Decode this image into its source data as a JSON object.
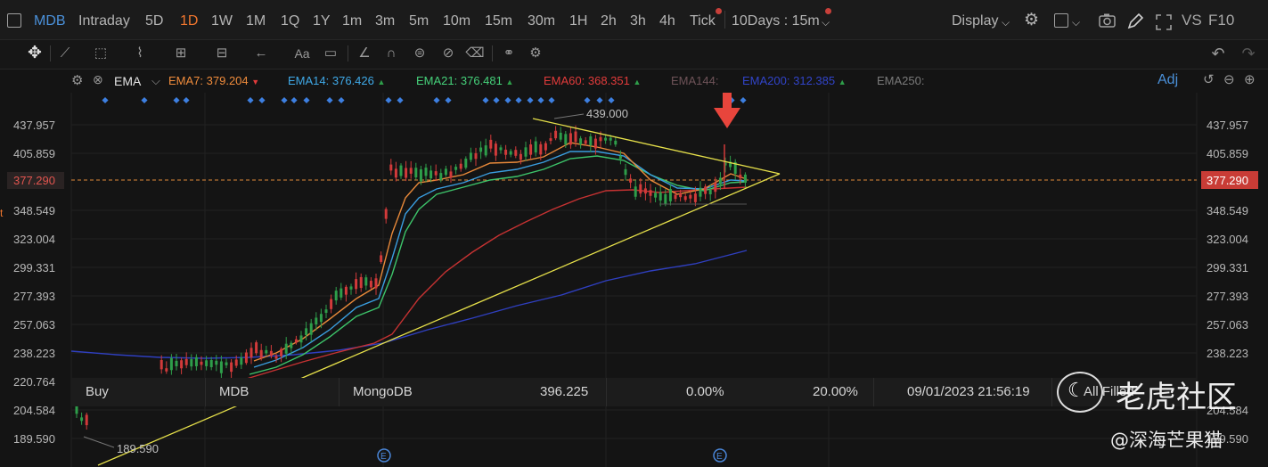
{
  "topbar": {
    "symbol": "MDB",
    "timeframes": [
      "Intraday",
      "5D",
      "1D",
      "1W",
      "1M",
      "1Q",
      "1Y",
      "1m",
      "3m",
      "5m",
      "10m",
      "15m",
      "30m",
      "1H",
      "2h",
      "3h",
      "4h",
      "Tick"
    ],
    "active_timeframe": "1D",
    "range_select": "10Days : 15m",
    "display_label": "Display",
    "vs_label": "VS",
    "f10_label": "F10"
  },
  "icons": {
    "settings": "gear-icon",
    "layout": "square-icon",
    "camera": "camera-icon",
    "pen": "pen-icon",
    "expand": "expand-icon",
    "undo": "undo-icon",
    "redo": "redo-icon",
    "move": "crosshair-move-icon"
  },
  "indicator_bar": {
    "name": "EMA",
    "items": [
      {
        "label": "EMA7:",
        "value": "379.204",
        "arrow": "▼",
        "color": "#f08c3c"
      },
      {
        "label": "EMA14:",
        "value": "376.426",
        "arrow": "▲",
        "color": "#3fa9e8"
      },
      {
        "label": "EMA21:",
        "value": "376.481",
        "arrow": "▲",
        "color": "#45d17a"
      },
      {
        "label": "EMA60:",
        "value": "368.351",
        "arrow": "▲",
        "color": "#e23b3b"
      },
      {
        "label": "EMA144:",
        "value": "",
        "arrow": "",
        "color": "#6e5358"
      },
      {
        "label": "EMA200:",
        "value": "312.385",
        "arrow": "▲",
        "color": "#3144c9"
      },
      {
        "label": "EMA250:",
        "value": "",
        "arrow": "",
        "color": "#7a7a7a"
      }
    ],
    "adj_label": "Adj"
  },
  "price_axis": {
    "ticks": [
      "437.957",
      "405.859",
      "377.290",
      "348.549",
      "323.004",
      "299.331",
      "277.393",
      "257.063",
      "238.223",
      "220.764",
      "204.584",
      "189.590"
    ],
    "current_price": "377.290",
    "high_label": "439.000",
    "low_label": "189.590",
    "left_mark": "t"
  },
  "info_bar": {
    "side": "Buy",
    "symbol": "MDB",
    "name": "MongoDB",
    "price": "396.225",
    "change": "0.00%",
    "ratio": "20.00%",
    "datetime": "09/01/2023 21:56:19",
    "filter": "All Filled"
  },
  "event_marker": "E",
  "watermark": {
    "brand": "老虎社区",
    "author": "@深海芒果猫"
  },
  "colors": {
    "up": "#2e9e4a",
    "down": "#d23a3a",
    "accent": "#f0762e",
    "trendline": "#e6e04a",
    "marker": "#e8453c",
    "signal_dots": "#3d7fe0"
  }
}
